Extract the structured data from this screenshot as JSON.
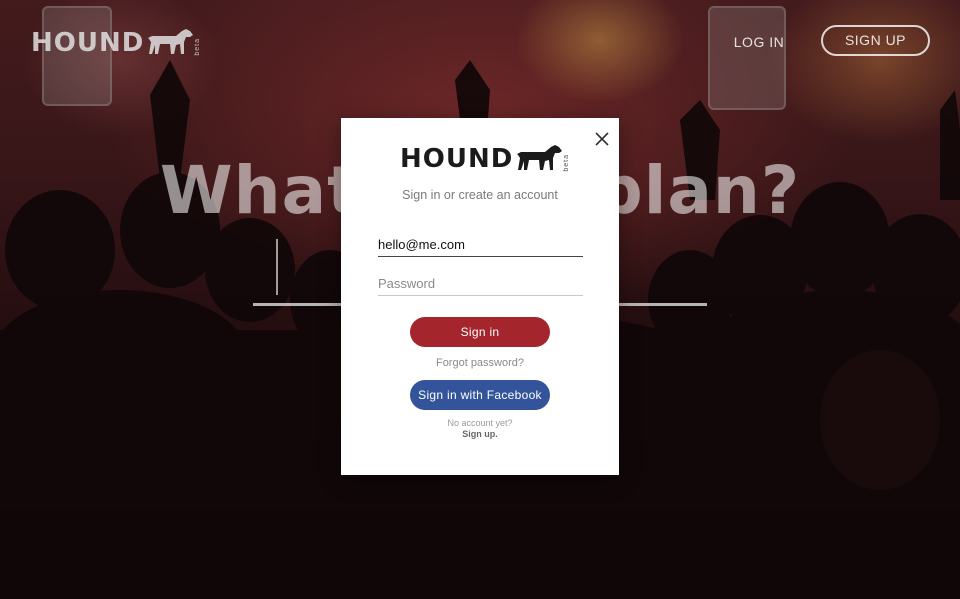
{
  "app": {
    "logo_text": "HOUND",
    "logo_badge": "beta",
    "hero_title": "What's the plan?"
  },
  "nav": {
    "login_label": "LOG IN",
    "signup_label": "SIGN UP"
  },
  "modal": {
    "logo_text": "HOUND",
    "logo_badge": "beta",
    "subtitle": "Sign in or create an account",
    "email_value": "hello@me.com",
    "password_placeholder": "Password",
    "signin_label": "Sign in",
    "forgot_label": "Forgot password?",
    "facebook_label": "Sign in with Facebook",
    "no_account_text": "No account yet?",
    "signup_link": "Sign up."
  },
  "colors": {
    "signin_button": "#a4262c",
    "facebook_button": "#33549a",
    "modal_bg": "#ffffff"
  },
  "icons": {
    "logo": "dog-icon",
    "close": "close-icon"
  }
}
